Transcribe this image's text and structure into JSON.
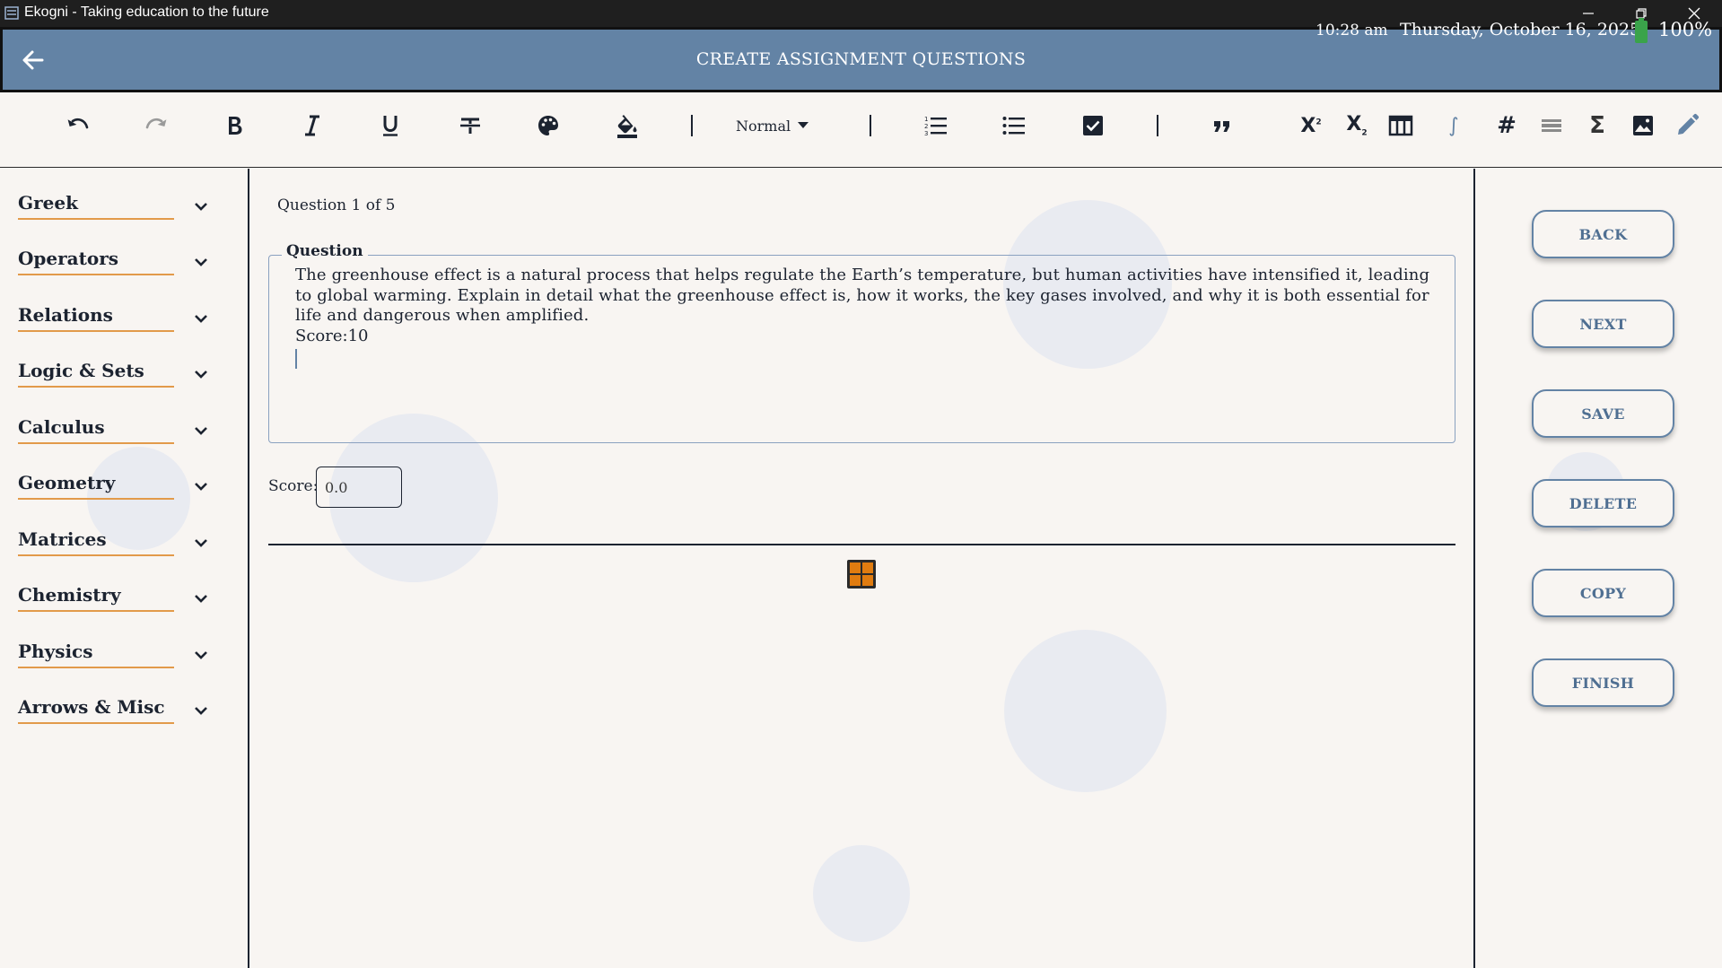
{
  "window": {
    "title": "Ekogni - Taking education to the future",
    "icons": [
      "app-icon",
      "minimize-icon",
      "restore-icon",
      "close-icon"
    ]
  },
  "header": {
    "title": "CREATE ASSIGNMENT QUESTIONS",
    "time": "10:28 am",
    "date": "Thursday, October 16, 2025",
    "battery": "100%",
    "colors": {
      "bar": "#6383a5",
      "battery": "#3aa34a"
    }
  },
  "toolbar": {
    "superscript_label": "X",
    "subscript_label": "X",
    "integral_label": "∫",
    "sigma_label": "Σ",
    "hash_label": "#",
    "heading_value": "Normal",
    "icons": [
      "undo-icon",
      "redo-icon",
      "bold-icon",
      "italic-icon",
      "underline-icon",
      "strikethrough-icon",
      "palette-icon",
      "fill-color-icon",
      "ordered-list-icon",
      "bullet-list-icon",
      "checkbox-icon",
      "quote-icon",
      "superscript-icon",
      "subscript-icon",
      "table-icon",
      "integral-icon",
      "hash-icon",
      "horizontal-rule-icon",
      "sigma-icon",
      "image-icon",
      "pencil-icon"
    ]
  },
  "sidebar": {
    "categories": [
      "Greek",
      "Operators",
      "Relations",
      "Logic & Sets",
      "Calculus",
      "Geometry",
      "Matrices",
      "Chemistry",
      "Physics",
      "Arrows & Misc"
    ],
    "accent": "#e29a4a"
  },
  "main": {
    "counter": "Question 1 of 5",
    "question_legend": "Question",
    "question_text": "The greenhouse effect is a natural process that helps regulate the Earth’s temperature, but human activities have intensified it, leading to global warming. Explain in detail what the greenhouse effect is, how it works, the key gases involved, and why it is both essential for life and dangerous when amplified.",
    "question_score_line": "Score:10",
    "score_label": "Score:",
    "score_value": "0.0",
    "grid_icon": "grid-icon",
    "grid_color": "#e07c10"
  },
  "actions": {
    "buttons": [
      "BACK",
      "NEXT",
      "SAVE",
      "DELETE",
      "COPY",
      "FINISH"
    ]
  }
}
